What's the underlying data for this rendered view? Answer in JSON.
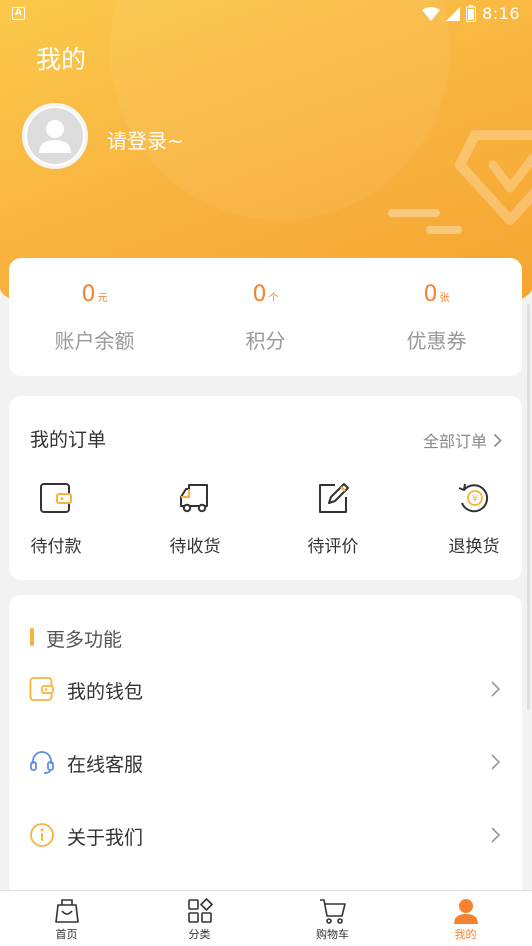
{
  "status_bar": {
    "time": "8:16",
    "app_indicator": "A"
  },
  "header": {
    "title": "我的",
    "login_prompt": "请登录~"
  },
  "account": {
    "stats": [
      {
        "value": "0",
        "unit": "元",
        "label": "账户余额"
      },
      {
        "value": "0",
        "unit": "个",
        "label": "积分"
      },
      {
        "value": "0",
        "unit": "张",
        "label": "优惠券"
      }
    ]
  },
  "orders": {
    "title": "我的订单",
    "all_label": "全部订单",
    "items": [
      {
        "label": "待付款",
        "icon": "wallet-icon"
      },
      {
        "label": "待收货",
        "icon": "truck-icon"
      },
      {
        "label": "待评价",
        "icon": "edit-icon"
      },
      {
        "label": "退换货",
        "icon": "refund-icon"
      }
    ]
  },
  "more": {
    "title": "更多功能",
    "items": [
      {
        "label": "我的钱包",
        "icon": "wallet-icon"
      },
      {
        "label": "在线客服",
        "icon": "headset-icon"
      },
      {
        "label": "关于我们",
        "icon": "info-icon"
      }
    ]
  },
  "tabbar": {
    "items": [
      {
        "label": "首页",
        "icon": "shopping-bag-icon"
      },
      {
        "label": "分类",
        "icon": "category-grid-icon"
      },
      {
        "label": "购物车",
        "icon": "cart-icon"
      },
      {
        "label": "我的",
        "icon": "user-icon",
        "active": true
      }
    ]
  },
  "colors": {
    "accent": "#f5822e",
    "header_gradient_start": "#fbc94b",
    "header_gradient_end": "#f6a531"
  }
}
